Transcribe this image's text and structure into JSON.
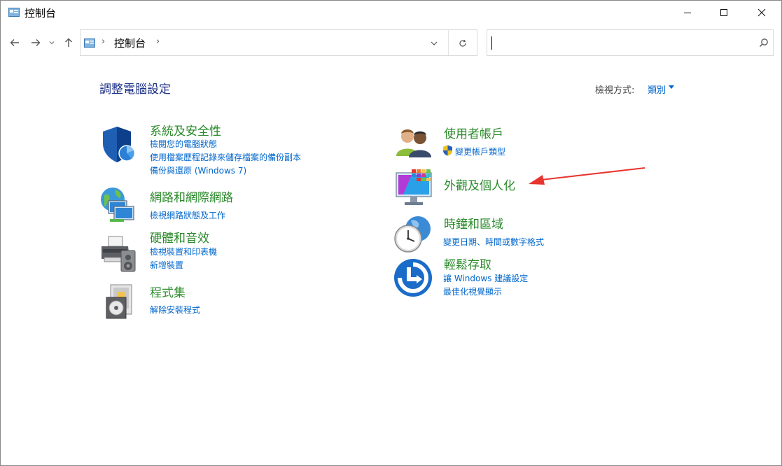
{
  "window": {
    "title": "控制台",
    "minimize_icon": "minimize-icon",
    "maximize_icon": "maximize-icon",
    "close_icon": "close-icon"
  },
  "nav": {
    "back_icon": "arrow-left-icon",
    "forward_icon": "arrow-right-icon",
    "recent_icon": "chevron-down-icon",
    "up_icon": "arrow-up-icon",
    "address": {
      "breadcrumb": "控制台",
      "separator": "›"
    },
    "refresh_icon": "refresh-icon",
    "search": {
      "value": "",
      "placeholder": ""
    }
  },
  "main": {
    "title": "調整電腦設定",
    "view_by_label": "檢視方式:",
    "view_by_value": "類別"
  },
  "categories": {
    "system_security": {
      "icon": "shield-icon",
      "title": "系統及安全性",
      "links": [
        "檢閱您的電腦狀態",
        "使用檔案歷程記錄來儲存檔案的備份副本",
        "備份與還原 (Windows 7)"
      ]
    },
    "network": {
      "icon": "network-globe-icon",
      "title": "網路和網際網路",
      "links": [
        "檢視網路狀態及工作"
      ]
    },
    "hardware": {
      "icon": "printer-speaker-icon",
      "title": "硬體和音效",
      "links": [
        "檢視裝置和印表機",
        "新增裝置"
      ]
    },
    "programs": {
      "icon": "programs-disc-icon",
      "title": "程式集",
      "links": [
        "解除安裝程式"
      ]
    },
    "user_accounts": {
      "icon": "users-icon",
      "title": "使用者帳戶",
      "links": [
        "變更帳戶類型"
      ]
    },
    "appearance": {
      "icon": "monitor-palette-icon",
      "title": "外觀及個人化",
      "links": []
    },
    "clock_region": {
      "icon": "clock-globe-icon",
      "title": "時鐘和區域",
      "links": [
        "變更日期、時間或數字格式"
      ]
    },
    "ease_of_access": {
      "icon": "ease-of-access-icon",
      "title": "輕鬆存取",
      "links": [
        "讓 Windows 建議設定",
        "最佳化視覺顯示"
      ]
    }
  },
  "colors": {
    "category_title": "#2a8a2a",
    "link": "#0066cc",
    "page_title": "#1e3287",
    "annotation_arrow": "#e8342e"
  }
}
